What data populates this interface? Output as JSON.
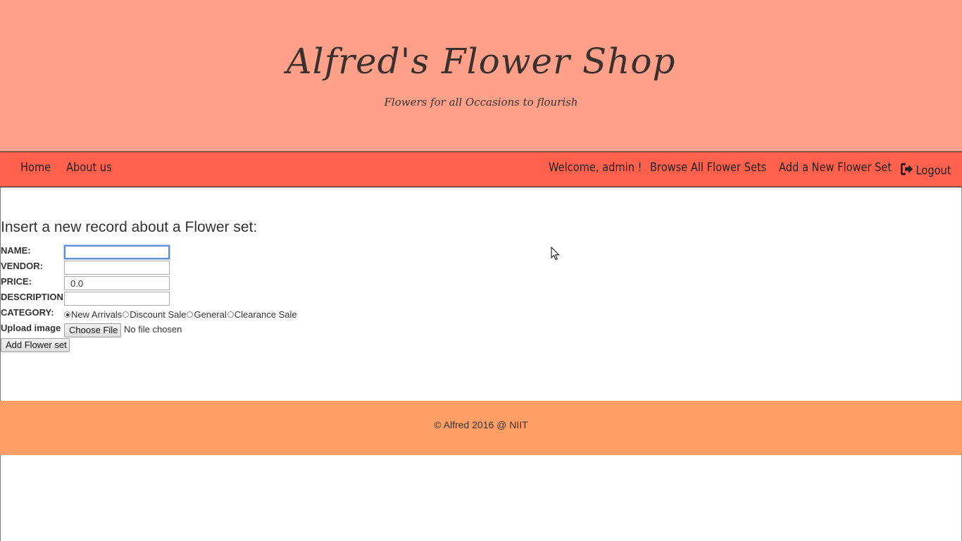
{
  "header": {
    "title": "Alfred's Flower Shop",
    "tagline": "Flowers for all Occasions to flourish"
  },
  "nav": {
    "home": "Home",
    "about": "About us",
    "welcome": "Welcome, admin !",
    "browse": "Browse All Flower Sets",
    "add_new": "Add a New Flower Set",
    "logout": "Logout",
    "logout_icon": "sign-out-icon"
  },
  "form": {
    "heading": "Insert a new record about a Flower set:",
    "name_label": "NAME:",
    "name_value": "",
    "vendor_label": "VENDOR:",
    "vendor_value": "",
    "price_label": "PRICE:",
    "price_value": "0.0",
    "description_label": "DESCRIPTION:",
    "description_value": "",
    "category_label": "CATEGORY:",
    "categories": [
      {
        "label": "New Arrivals",
        "checked": true
      },
      {
        "label": "Discount Sale",
        "checked": false
      },
      {
        "label": "General",
        "checked": false
      },
      {
        "label": "Clearance Sale",
        "checked": false
      }
    ],
    "upload_label": "Upload image",
    "choose_file_button": "Choose File",
    "file_status": "No file chosen",
    "submit_button": "Add Flower set"
  },
  "footer": {
    "copyright": "© Alfred 2016 @ NIIT"
  },
  "colors": {
    "header_bg": "#ffa08a",
    "nav_bg": "#ff614c",
    "footer_bg": "#ff9f66"
  }
}
